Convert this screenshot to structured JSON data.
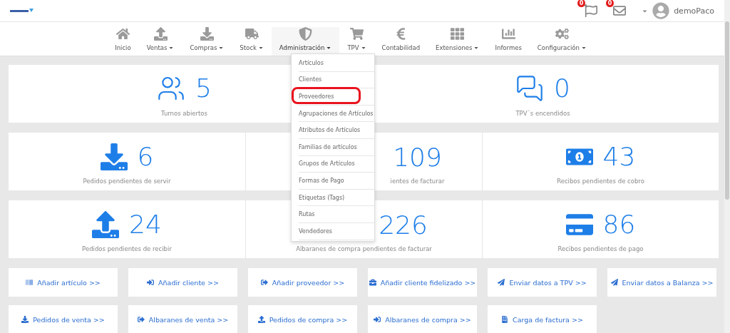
{
  "header": {
    "notifications": [
      {
        "count": "0"
      },
      {
        "count": "0"
      }
    ],
    "user": "demoPaco"
  },
  "nav": [
    {
      "label": "Inicio",
      "dropdown": false,
      "selected": false
    },
    {
      "label": "Ventas",
      "dropdown": true,
      "selected": false
    },
    {
      "label": "Compras",
      "dropdown": true,
      "selected": false
    },
    {
      "label": "Stock",
      "dropdown": true,
      "selected": false
    },
    {
      "label": "Administración",
      "dropdown": true,
      "selected": true
    },
    {
      "label": "TPV",
      "dropdown": true,
      "selected": false
    },
    {
      "label": "Contabilidad",
      "dropdown": false,
      "selected": false
    },
    {
      "label": "Extensiones",
      "dropdown": true,
      "selected": false
    },
    {
      "label": "Informes",
      "dropdown": false,
      "selected": false
    },
    {
      "label": "Configuración",
      "dropdown": true,
      "selected": false
    }
  ],
  "menu": [
    {
      "label": "Artículos",
      "circled": false
    },
    {
      "label": "Clientes",
      "circled": false
    },
    {
      "label": "Proveedores",
      "circled": true
    },
    {
      "label": "Agrupaciones de Artículos",
      "circled": false
    },
    {
      "label": "Atributos de Artículos",
      "circled": false
    },
    {
      "label": "Familias de artículos",
      "circled": false
    },
    {
      "label": "Grupos de Artículos",
      "circled": false
    },
    {
      "label": "Formas de Pago",
      "circled": false
    },
    {
      "label": "Etiquetas (Tags)",
      "circled": false
    },
    {
      "label": "Rutas",
      "circled": false
    },
    {
      "label": "Vendedores",
      "circled": false
    }
  ],
  "stat_rows": [
    [
      {
        "value": "5",
        "label": "Turnos abiertos"
      },
      {
        "value": "0",
        "label": "TPV´s encendidos"
      }
    ],
    [
      {
        "value": "6",
        "label": "Pedidos pendientes de servir"
      },
      {
        "value": "109",
        "label": "ientes de facturar"
      },
      {
        "value": "43",
        "label": "Recibos pendientes de cobro"
      }
    ],
    [
      {
        "value": "24",
        "label": "Pedidos pendientes de recibir"
      },
      {
        "value": "226",
        "label": "Albaranes de compra pendientes de facturar"
      },
      {
        "value": "86",
        "label": "Recibos pendientes de pago"
      }
    ]
  ],
  "shortcuts": [
    [
      "Añadir artículo >>",
      "Añadir cliente >>",
      "Añadir proveedor >>",
      "Añadir cliente fidelizado >>",
      "Enviar datos a TPV >>",
      "Enviar datos a Balanza >>"
    ],
    [
      "Pedidos de venta >>",
      "Albaranes de venta >>",
      "Pedidos de compra >>",
      "Albaranes de compra >>",
      "Carga de factura >>"
    ]
  ]
}
